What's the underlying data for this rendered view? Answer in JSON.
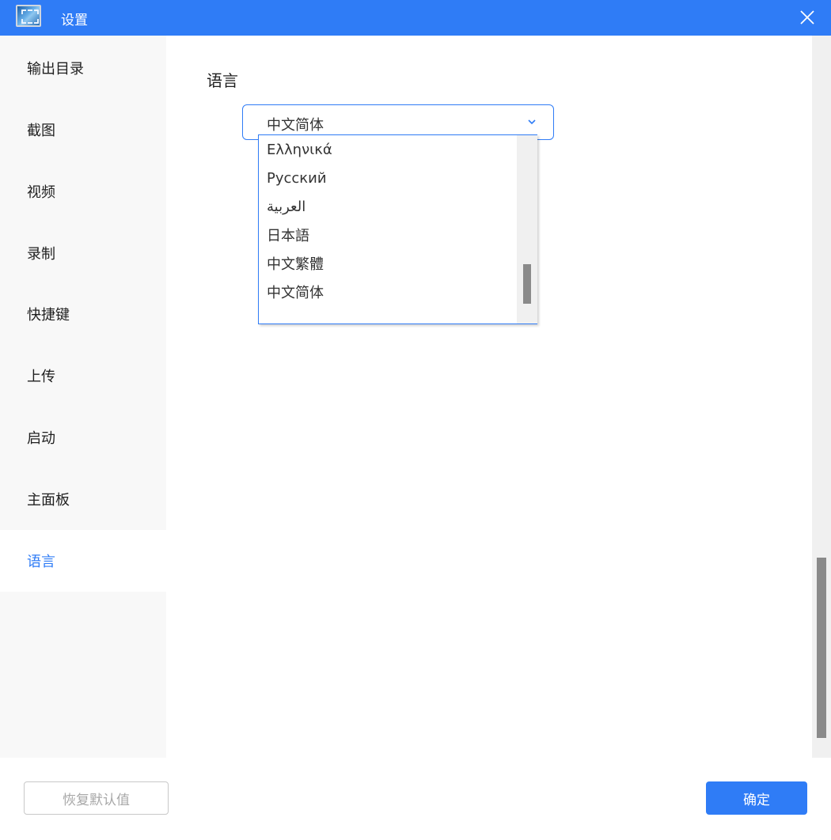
{
  "window": {
    "title": "设置",
    "accent_color": "#2f7cf6"
  },
  "sidebar": {
    "items": [
      {
        "label": "输出目录"
      },
      {
        "label": "截图"
      },
      {
        "label": "视频"
      },
      {
        "label": "录制"
      },
      {
        "label": "快捷键"
      },
      {
        "label": "上传"
      },
      {
        "label": "启动"
      },
      {
        "label": "主面板"
      },
      {
        "label": "语言"
      }
    ],
    "active": "语言"
  },
  "main": {
    "section_title": "语言",
    "language_select": {
      "selected": "中文简体",
      "options": [
        "Ελληνικά",
        "Русский",
        "العربية",
        "日本語",
        "中文繁體",
        "中文简体"
      ]
    }
  },
  "footer": {
    "reset_label": "恢复默认值",
    "ok_label": "确定"
  }
}
